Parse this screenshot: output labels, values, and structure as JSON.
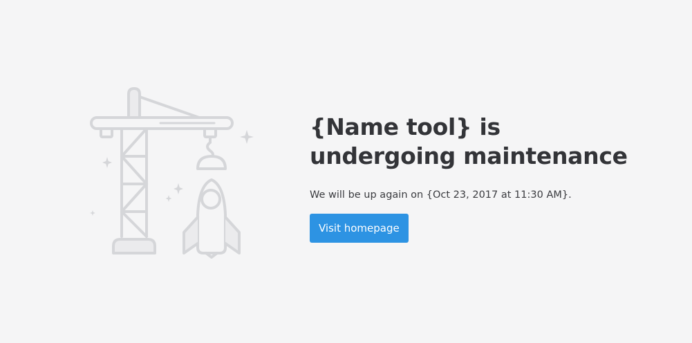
{
  "heading": {
    "line1": "{Name tool} is",
    "line2": "undergoing maintenance"
  },
  "message": "We will be up again on {Oct 23, 2017 at 11:30 AM}.",
  "action": {
    "label": "Visit homepage"
  },
  "illustration": {
    "icon": "crane-lifting-rocket-icon",
    "stroke_color": "#d5d6d9",
    "fill_color": "#ebebed"
  },
  "colors": {
    "background": "#f5f5f6",
    "heading": "#333438",
    "button": "#2d93e3"
  }
}
